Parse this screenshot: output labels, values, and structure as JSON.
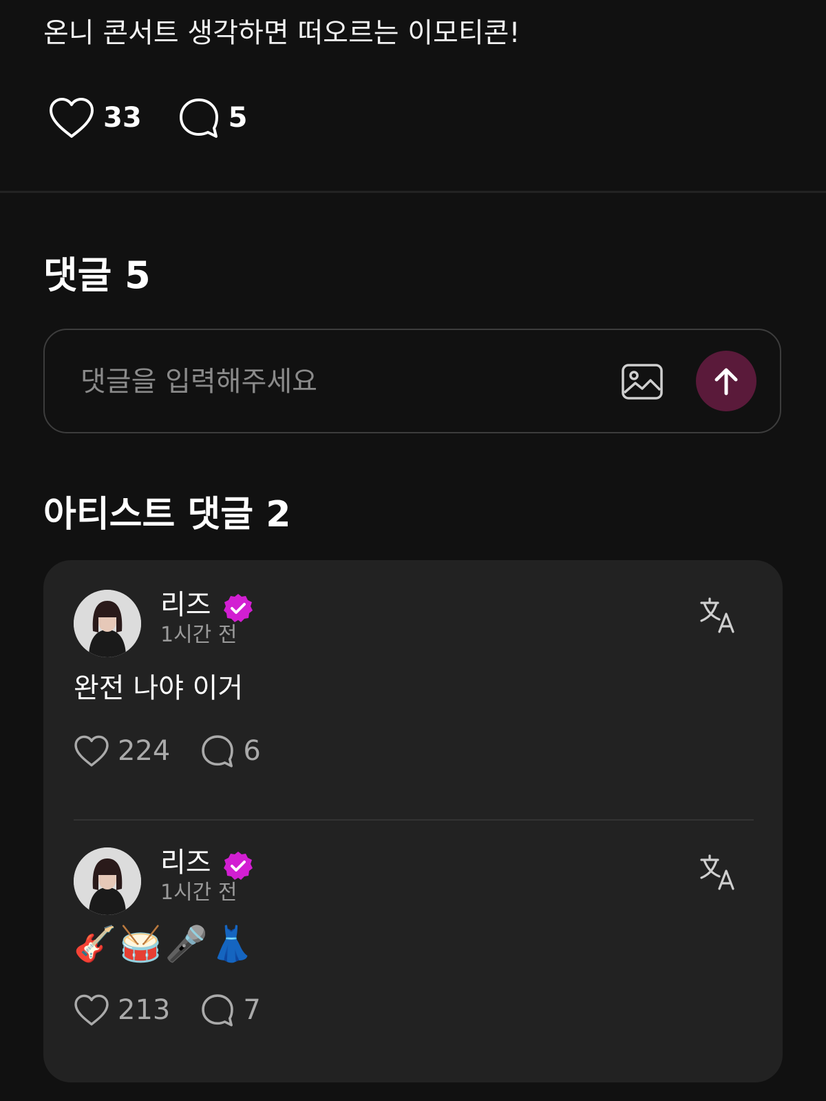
{
  "post": {
    "text": "온니 콘서트 생각하면 떠오르는 이모티콘!",
    "like_count": "33",
    "comment_count": "5"
  },
  "comments_section": {
    "title": "댓글 5",
    "input_placeholder": "댓글을 입력해주세요"
  },
  "artist_section": {
    "title": "아티스트 댓글 2",
    "comments": [
      {
        "name": "리즈",
        "time": "1시간 전",
        "text": "완전 나야 이거",
        "likes": "224",
        "replies": "6"
      },
      {
        "name": "리즈",
        "time": "1시간 전",
        "text": "🎸🥁🎤👗",
        "likes": "213",
        "replies": "7"
      }
    ]
  },
  "icons": {
    "like": "heart-icon",
    "comment": "speech-bubble-icon",
    "image": "image-icon",
    "send": "arrow-up-icon",
    "verified": "verified-badge-icon",
    "translate": "translate-icon"
  },
  "colors": {
    "background": "#111111",
    "card": "#222222",
    "send_button": "#5a1a3a",
    "verified_badge": "#d21fd2"
  }
}
